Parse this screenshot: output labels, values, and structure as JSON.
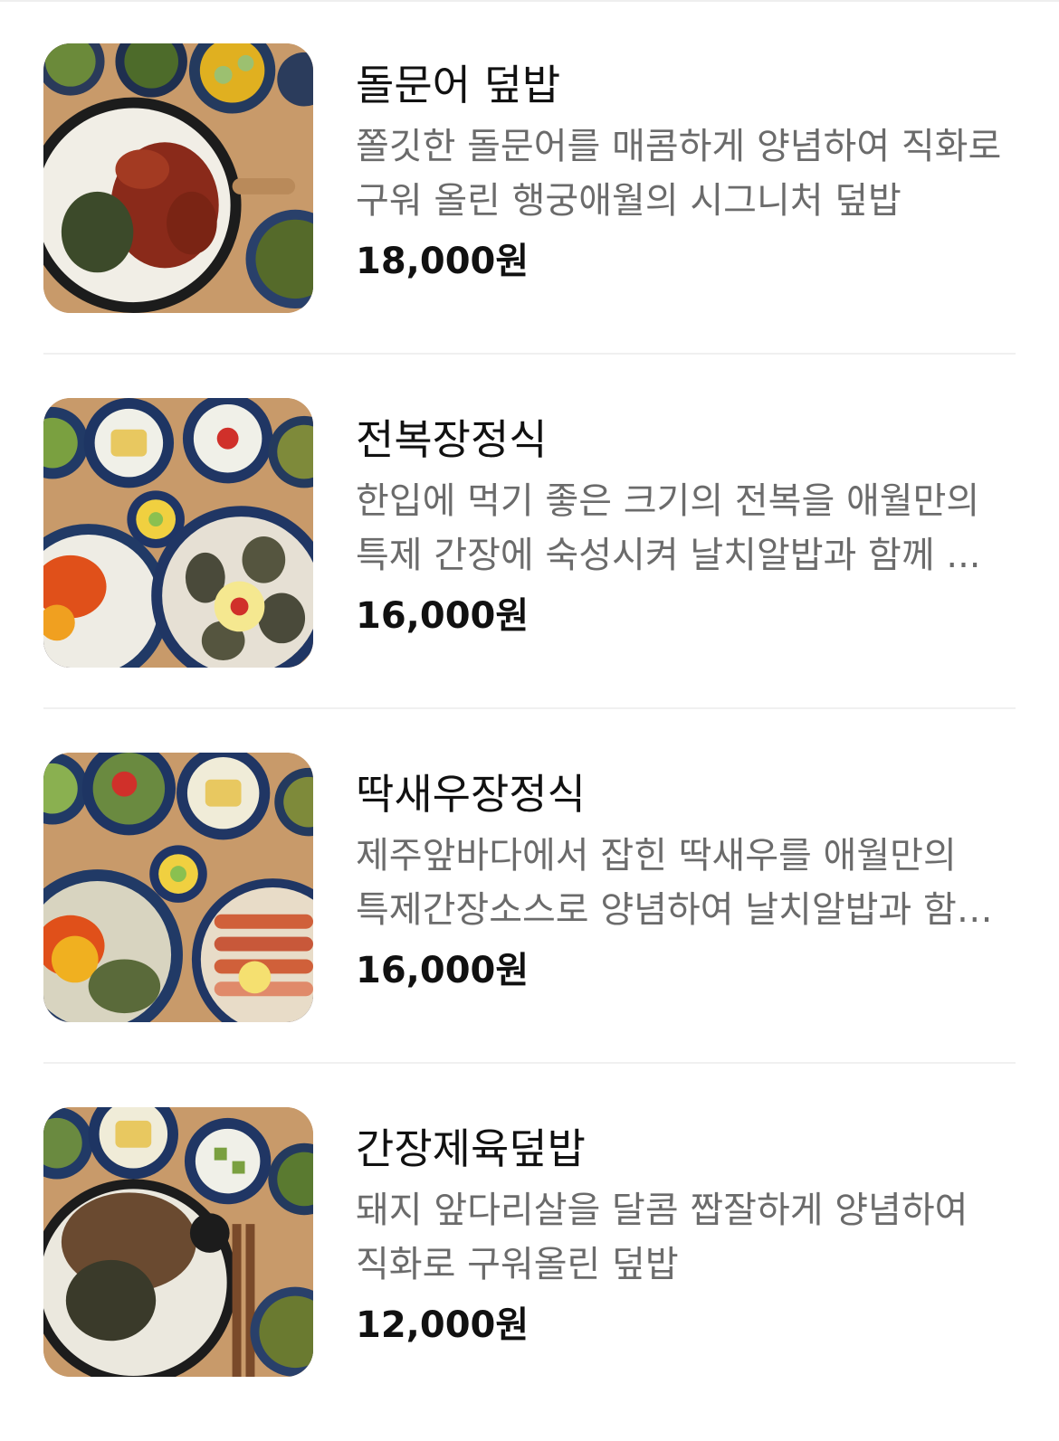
{
  "menu": {
    "items": [
      {
        "name": "돌문어 덮밥",
        "description": "쫄깃한 돌문어를 매콤하게 양념하여 직화로 구워 올린 행궁애월의 시그니처 덮밥",
        "price": "18,000원",
        "image_icon": "octopus-rice-bowl-photo"
      },
      {
        "name": "전복장정식",
        "description": "한입에 먹기 좋은 크기의 전복을 애월만의 특제 간장에 숙성시켜 날치알밥과 함께 ...",
        "price": "16,000원",
        "image_icon": "abalone-set-meal-photo"
      },
      {
        "name": "딱새우장정식",
        "description": "제주앞바다에서 잡힌 딱새우를 애월만의 특제간장소스로 양념하여 날치알밥과 함께 ...",
        "price": "16,000원",
        "image_icon": "shrimp-set-meal-photo"
      },
      {
        "name": "간장제육덮밥",
        "description": "돼지 앞다리살을 달콤 짭잘하게 양념하여 직화로 구워올린 덮밥",
        "price": "12,000원",
        "image_icon": "soy-pork-rice-bowl-photo"
      }
    ]
  },
  "colors": {
    "name_text": "#111111",
    "description_text": "#6b6b6b",
    "price_text": "#111111",
    "divider": "#f0f0f0",
    "wood_table": "#c89a6a"
  }
}
